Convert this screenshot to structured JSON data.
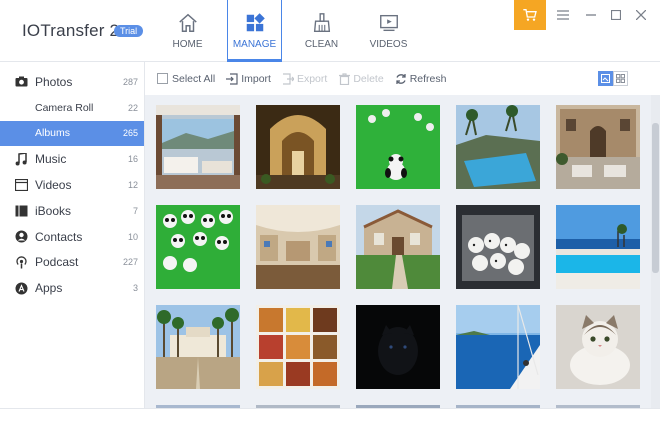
{
  "app": {
    "title": "IOTransfer 2",
    "badge": "Trial"
  },
  "nav": [
    {
      "label": "HOME",
      "icon": "home-icon",
      "active": false
    },
    {
      "label": "MANAGE",
      "icon": "grid-icon",
      "active": true
    },
    {
      "label": "CLEAN",
      "icon": "broom-icon",
      "active": false
    },
    {
      "label": "VIDEOS",
      "icon": "video-icon",
      "active": false
    }
  ],
  "window": {
    "cart_icon": "cart-icon",
    "menu_icon": "menu-icon",
    "minimize_icon": "minimize-icon",
    "maximize_icon": "maximize-icon",
    "close_icon": "close-icon",
    "accent": "#f5a623"
  },
  "sidebar": {
    "items": [
      {
        "label": "Photos",
        "count": "287",
        "icon": "camera-icon"
      },
      {
        "label": "Camera Roll",
        "count": "22",
        "sub": true
      },
      {
        "label": "Albums",
        "count": "265",
        "sub": true,
        "active": true
      },
      {
        "label": "Music",
        "count": "16",
        "icon": "music-note-icon"
      },
      {
        "label": "Videos",
        "count": "12",
        "icon": "film-icon"
      },
      {
        "label": "iBooks",
        "count": "7",
        "icon": "book-icon"
      },
      {
        "label": "Contacts",
        "count": "10",
        "icon": "contact-icon"
      },
      {
        "label": "Podcast",
        "count": "227",
        "icon": "podcast-icon"
      },
      {
        "label": "Apps",
        "count": "3",
        "icon": "apps-icon"
      }
    ]
  },
  "toolbar": {
    "select_all": "Select All",
    "import": "Import",
    "export": "Export",
    "delete": "Delete",
    "refresh": "Refresh"
  },
  "photos": [
    {
      "subject": "living room with sea view"
    },
    {
      "subject": "ornate hallway"
    },
    {
      "subject": "panda toy on green screen"
    },
    {
      "subject": "pool with palm trees"
    },
    {
      "subject": "villa courtyard"
    },
    {
      "subject": "many panda toys on green screen"
    },
    {
      "subject": "private jet interior"
    },
    {
      "subject": "house with garden path"
    },
    {
      "subject": "puppies in car trunk"
    },
    {
      "subject": "infinity pool by the sea"
    },
    {
      "subject": "mansion with palm trees"
    },
    {
      "subject": "food collage"
    },
    {
      "subject": "black panther"
    },
    {
      "subject": "sailboat at sea"
    },
    {
      "subject": "cat on floor"
    }
  ],
  "colors": {
    "accent": "#5b8fe6",
    "grid_bg": "#edf0f5"
  }
}
